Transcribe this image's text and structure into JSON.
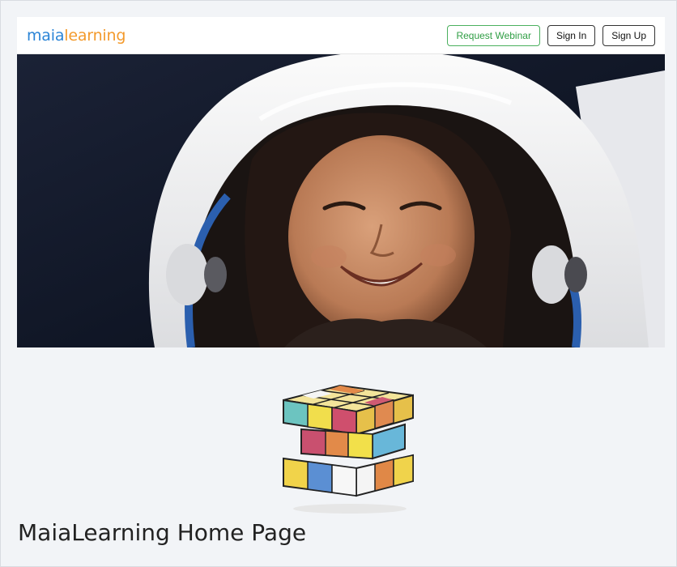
{
  "header": {
    "logo_part1": "maia",
    "logo_part2": "learning",
    "buttons": {
      "webinar": "Request Webinar",
      "sign_in": "Sign In",
      "sign_up": "Sign Up"
    }
  },
  "colors": {
    "logo_blue": "#2b84d6",
    "logo_orange": "#f39a2c",
    "webinar_green": "#2f9e44",
    "background": "#f2f4f7"
  },
  "page": {
    "title": "MaiaLearning Home Page"
  }
}
